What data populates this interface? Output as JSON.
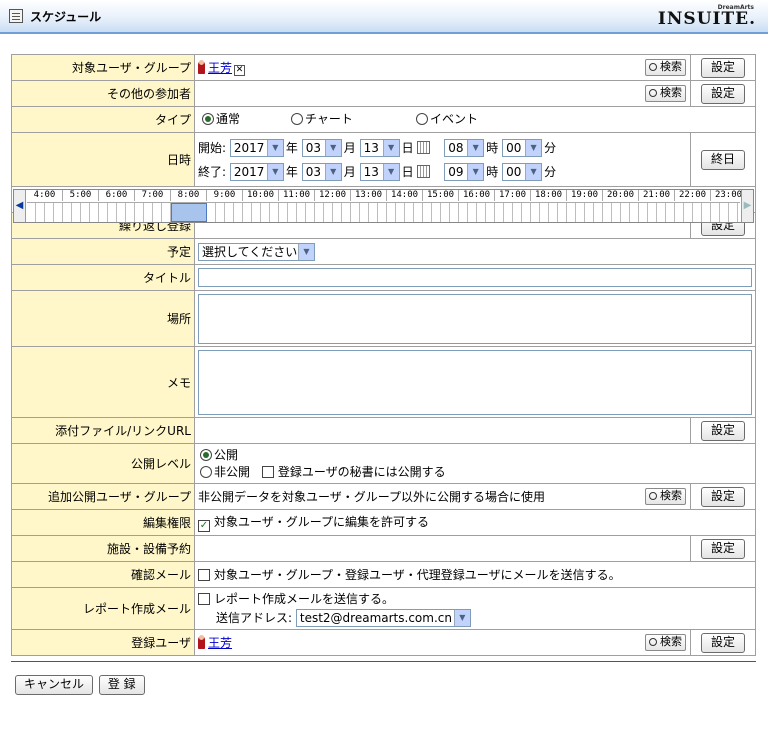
{
  "header": {
    "title": "スケジュール",
    "brand_small": "DreamArts",
    "brand": "INSUITE."
  },
  "buttons": {
    "set": "設定",
    "search": "検索",
    "all_day": "終日",
    "cancel": "キャンセル",
    "register": "登 録"
  },
  "rows": {
    "target": {
      "label": "対象ユーザ・グループ",
      "user": "王芳"
    },
    "other": {
      "label": "その他の参加者"
    },
    "type": {
      "label": "タイプ",
      "options": [
        "通常",
        "チャート",
        "イベント"
      ],
      "selected": "通常"
    },
    "datetime": {
      "label": "日時",
      "start_label": "開始:",
      "end_label": "終了:",
      "year_unit": "年",
      "month_unit": "月",
      "day_unit": "日",
      "hour_unit": "時",
      "min_unit": "分",
      "start": {
        "year": "2017",
        "month": "03",
        "day": "13",
        "hour": "08",
        "minute": "00"
      },
      "end": {
        "year": "2017",
        "month": "03",
        "day": "13",
        "hour": "09",
        "minute": "00"
      }
    },
    "timeline": {
      "hours": [
        "4:00",
        "5:00",
        "6:00",
        "7:00",
        "8:00",
        "9:00",
        "10:00",
        "11:00",
        "12:00",
        "13:00",
        "14:00",
        "15:00",
        "16:00",
        "17:00",
        "18:00",
        "19:00",
        "20:00",
        "21:00",
        "22:00",
        "23:00"
      ]
    },
    "repeat": {
      "label": "繰り返し登録"
    },
    "plan": {
      "label": "予定",
      "value": "選択してください"
    },
    "title": {
      "label": "タイトル"
    },
    "place": {
      "label": "場所"
    },
    "memo": {
      "label": "メモ"
    },
    "attach": {
      "label": "添付ファイル/リンクURL"
    },
    "public_level": {
      "label": "公開レベル",
      "public": "公開",
      "private": "非公開",
      "secretary": "登録ユーザの秘書には公開する"
    },
    "extra_public": {
      "label": "追加公開ユーザ・グループ",
      "note": "非公開データを対象ユーザ・グループ以外に公開する場合に使用"
    },
    "edit_perm": {
      "label": "編集権限",
      "text": "対象ユーザ・グループに編集を許可する"
    },
    "facility": {
      "label": "施設・設備予約"
    },
    "confirm_mail": {
      "label": "確認メール",
      "text": "対象ユーザ・グループ・登録ユーザ・代理登録ユーザにメールを送信する。"
    },
    "report_mail": {
      "label": "レポート作成メール",
      "text": "レポート作成メールを送信する。",
      "address_label": "送信アドレス:",
      "address": "test2@dreamarts.com.cn"
    },
    "registrant": {
      "label": "登録ユーザ",
      "user": "王芳"
    }
  }
}
